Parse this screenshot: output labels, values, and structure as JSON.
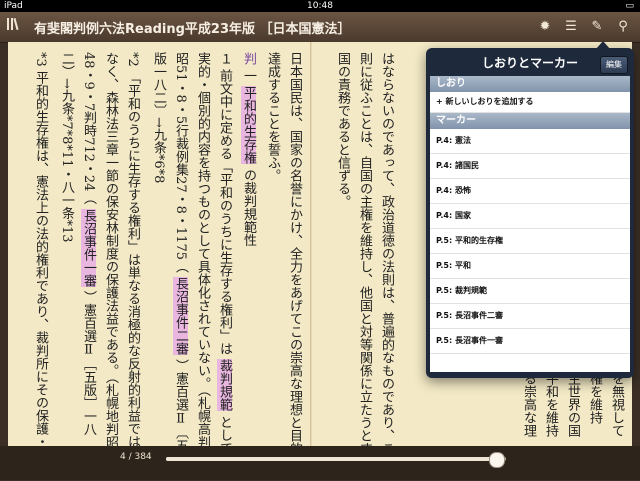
{
  "status": {
    "carrier": "iPad",
    "time": "10:48",
    "battery": "▭"
  },
  "toolbar": {
    "back_icon": "library-icon",
    "title": "有斐閣判例六法Reading平成23年版 ［日本国憲法］"
  },
  "left_page": {
    "columns": [
      {
        "text": "日本国民は、国家の名誉にかけ、全力をあげてこの崇高な理想と目的を"
      },
      {
        "text": "達成することを誓ふ。"
      },
      {
        "marker": "判",
        "text": "一",
        "hl": "平和的生存権",
        "tail": "の裁判規範性"
      },
      {
        "text": "１ 前文中に定める「平和のうちに生存する権利」は",
        "hl": "裁判規範",
        "tail": "として現"
      },
      {
        "text": "実的・個別的内容を持つものとして具体化されていない。（札幌高判"
      },
      {
        "text": "昭51・8・5行裁例集27・8・1175（",
        "hl": "長沼事件二審",
        "tail": "）憲百選Ⅱ〔五"
      },
      {
        "text": "版一八二〕→九条*6*8"
      },
      {
        "text": "*2 「平和のうちに生存する権利」は単なる消極的な反射的利益では"
      },
      {
        "text": "なく、森林法三章一節の保安林制度の保護法益である。（札幌地判昭"
      },
      {
        "text": "48・9・7判時712・24（",
        "hl": "長沼事件一審",
        "tail": "）憲百選Ⅱ［五版］一八"
      },
      {
        "text": "二）→九条*7*8*11・八一条*13"
      },
      {
        "text": "*3 平和的生存権は、憲法上の法的権利であり、裁判所にその保護・"
      }
    ]
  },
  "right_page": {
    "columns": [
      {
        "text": "はならないのであって、政治道徳の法則は、普遍的なものであり、この法"
      },
      {
        "text": "則に従ふことは、自国の主権を維持し、他国と対等関係に立たうとする各"
      },
      {
        "text": "国の責務であると信ずる。"
      }
    ],
    "edge_columns": [
      "を無視して",
      "権を維持",
      "主世界の国",
      "平和を維持",
      "る崇高な理"
    ]
  },
  "popover": {
    "title": "しおりとマーカー",
    "edit_label": "編集",
    "bookmarks_header": "しおり",
    "add_bookmark": "+ 新しいしおりを追加する",
    "markers_header": "マーカー",
    "markers": [
      "P.4: 憲法",
      "P.4: 諸国民",
      "P.4: 恐怖",
      "P.4: 国家",
      "P.5: 平和的生存権",
      "P.5: 平和",
      "P.5: 裁判規範",
      "P.5: 長沼事件二審",
      "P.5: 長沼事件一審"
    ]
  },
  "pager": {
    "label": "4 / 384",
    "progress": 0.97
  },
  "icons": [
    "settings-icon",
    "list-icon",
    "marker-pen-icon",
    "search-icon"
  ]
}
